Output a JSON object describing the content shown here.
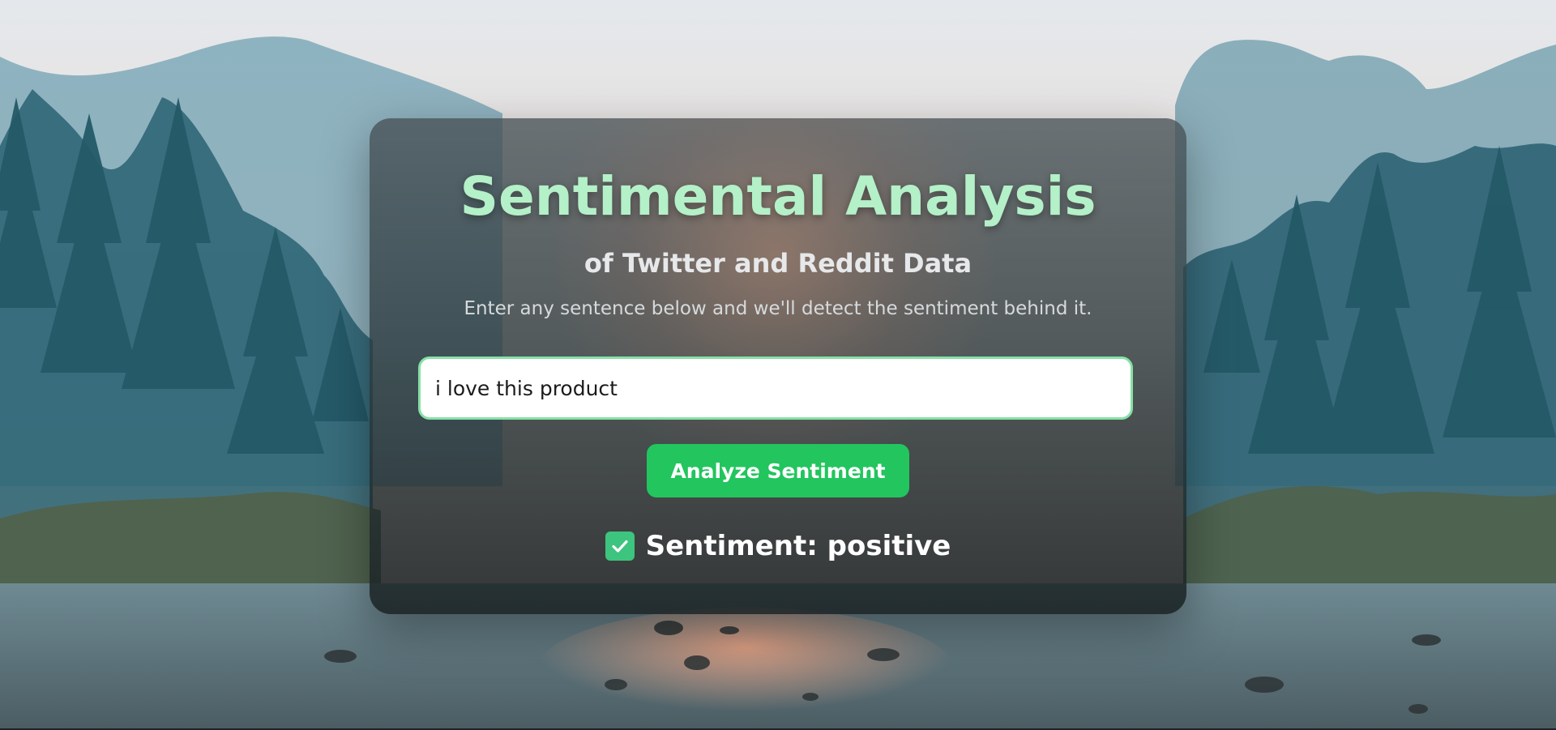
{
  "app": {
    "title": "Sentimental Analysis",
    "subtitle": "of Twitter and Reddit Data",
    "description": "Enter any sentence below and we'll detect the sentiment behind it."
  },
  "input": {
    "value": "i love this product",
    "placeholder": ""
  },
  "actions": {
    "analyze_label": "Analyze Sentiment"
  },
  "result": {
    "icon": "check-icon",
    "text": "Sentiment: positive"
  },
  "colors": {
    "title": "#b4f0c8",
    "accent": "#22c55e",
    "input_border": "#86e0a6"
  }
}
